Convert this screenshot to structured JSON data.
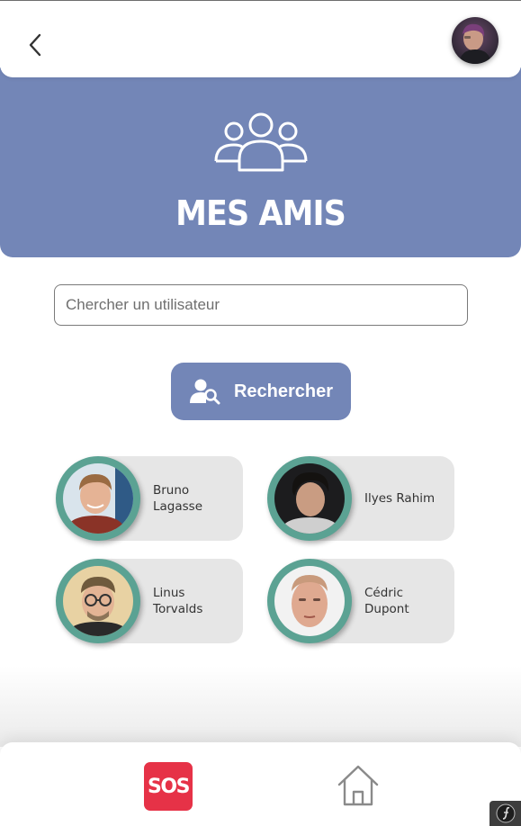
{
  "header": {
    "title": "MES AMIS"
  },
  "search": {
    "placeholder": "Chercher un utilisateur",
    "value": "",
    "button_label": "Rechercher"
  },
  "friends": [
    {
      "name_line1": "Bruno",
      "name_line2": "Lagasse"
    },
    {
      "name_line1": "Ilyes Rahim",
      "name_line2": ""
    },
    {
      "name_line1": "Linus",
      "name_line2": "Torvalds"
    },
    {
      "name_line1": "Cédric",
      "name_line2": "Dupont"
    }
  ],
  "bottom_nav": {
    "sos_label": "SOS"
  },
  "icons": {
    "back": "chevron-left-icon",
    "friends": "users-group-icon",
    "search": "user-search-icon",
    "home": "home-icon"
  },
  "colors": {
    "accent": "#7386b7",
    "avatar_ring": "#5ba293",
    "card_bg": "#e6e6e6",
    "sos": "#e63247"
  }
}
